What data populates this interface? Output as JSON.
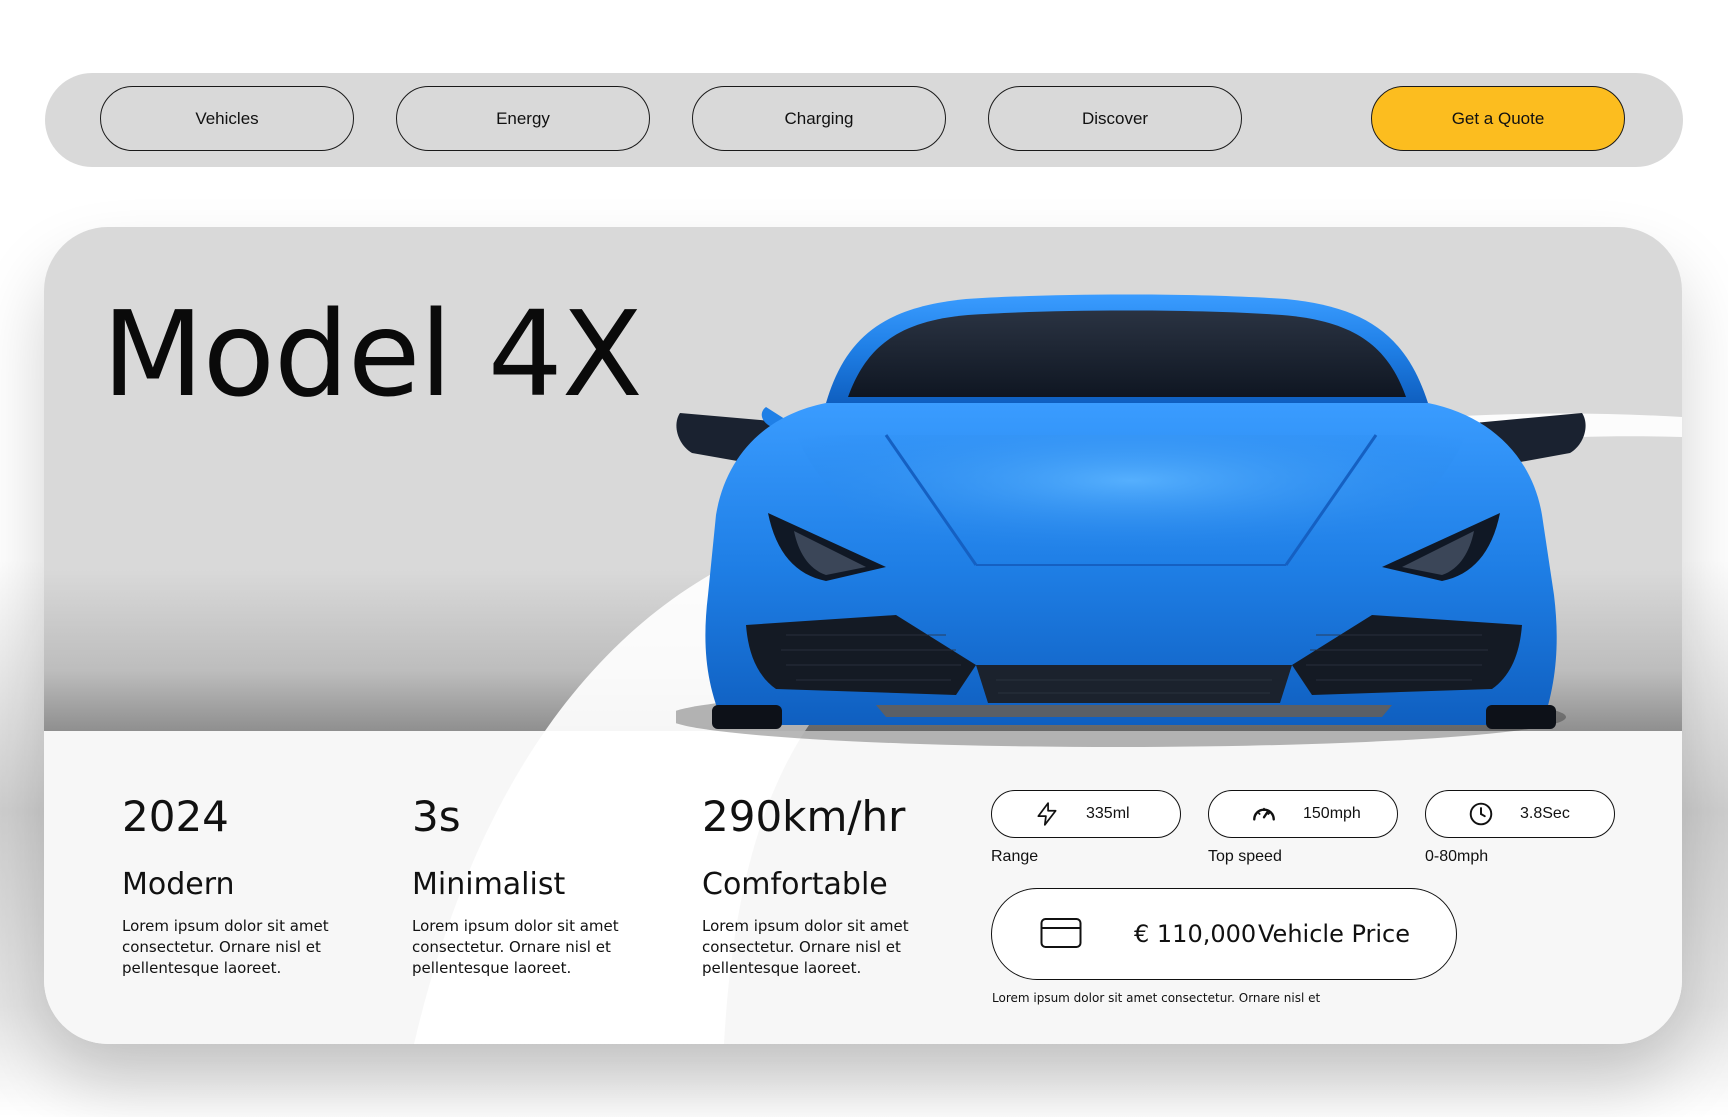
{
  "nav": {
    "items": [
      {
        "label": "Vehicles"
      },
      {
        "label": "Energy"
      },
      {
        "label": "Charging"
      },
      {
        "label": "Discover"
      }
    ],
    "cta_label": "Get a Quote",
    "cta_color": "#fcbd1f"
  },
  "hero": {
    "title": "Model 4X",
    "car_color": "#1f7fe6"
  },
  "features": [
    {
      "stat": "2024",
      "name": "Modern",
      "desc": "Lorem ipsum dolor sit amet consectetur. Ornare nisl et pellentesque laoreet."
    },
    {
      "stat": "3s",
      "name": "Minimalist",
      "desc": "Lorem ipsum dolor sit amet consectetur. Ornare nisl et pellentesque laoreet."
    },
    {
      "stat": "290km/hr",
      "name": "Comfortable",
      "desc": "Lorem ipsum dolor sit amet consectetur. Ornare nisl et pellentesque laoreet."
    }
  ],
  "specs": [
    {
      "icon": "lightning-icon",
      "value": "335ml",
      "label": "Range"
    },
    {
      "icon": "speedometer-icon",
      "value": "150mph",
      "label": "Top speed"
    },
    {
      "icon": "clock-icon",
      "value": "3.8Sec",
      "label": "0-80mph"
    }
  ],
  "price": {
    "icon": "credit-card-icon",
    "amount": "€ 110,000",
    "label": "Vehicle Price",
    "note": "Lorem ipsum dolor sit amet consectetur. Ornare nisl et"
  }
}
